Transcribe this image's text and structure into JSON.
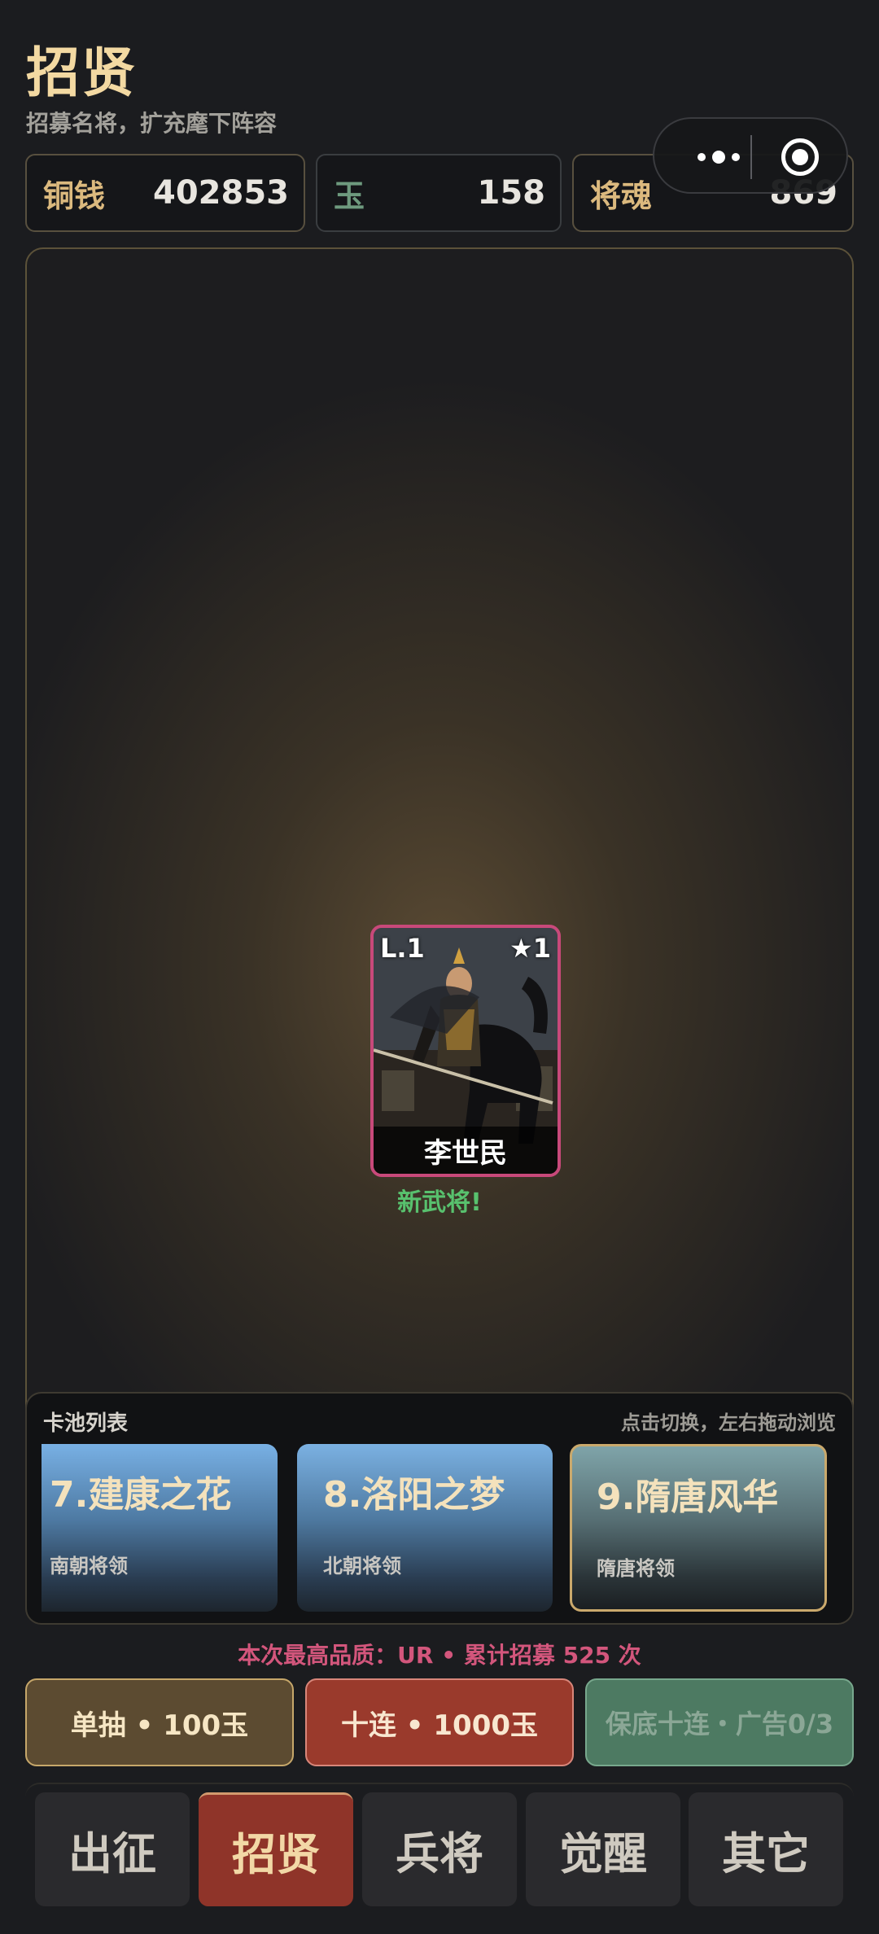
{
  "header": {
    "title": "招贤",
    "subtitle": "招募名将，扩充麾下阵容"
  },
  "resources": {
    "coin": {
      "label": "铜钱",
      "value": "402853"
    },
    "jade": {
      "label": "玉",
      "value": "158"
    },
    "soul": {
      "label": "将魂",
      "value": "869"
    }
  },
  "hero_card": {
    "level": "L.1",
    "stars": "★1",
    "name": "李世民",
    "frame_color": "#c8497a",
    "status": "新武将!"
  },
  "pool": {
    "title": "卡池列表",
    "hint": "点击切换，左右拖动浏览",
    "items": [
      {
        "title": "7.建康之花",
        "subtitle": "南朝将领"
      },
      {
        "title": "8.洛阳之梦",
        "subtitle": "北朝将领"
      },
      {
        "title": "9.隋唐风华",
        "subtitle": "隋唐将领",
        "selected": true
      }
    ]
  },
  "summary": "本次最高品质：UR  •  累计招募 525 次",
  "actions": {
    "single": "单抽  •  100玉",
    "ten": "十连  •  1000玉",
    "guarantee": "保底十连・广告0/3"
  },
  "nav": {
    "tabs": [
      {
        "label": "出征"
      },
      {
        "label": "招贤",
        "active": true
      },
      {
        "label": "兵将"
      },
      {
        "label": "觉醒"
      },
      {
        "label": "其它"
      }
    ]
  },
  "colors": {
    "accent_gold": "#f3d9a2",
    "ur_pink": "#d3567c",
    "new_green": "#58c16e"
  }
}
